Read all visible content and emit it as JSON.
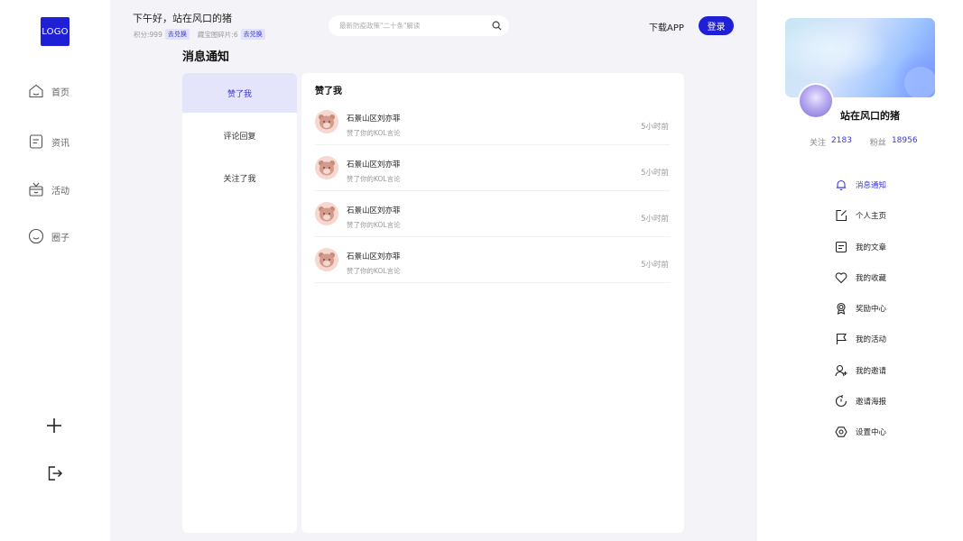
{
  "logo": {
    "text": "LOGO"
  },
  "leftnav": {
    "items": [
      {
        "label": "首页",
        "icon": "home-icon"
      },
      {
        "label": "资讯",
        "icon": "news-icon"
      },
      {
        "label": "活动",
        "icon": "gift-icon"
      },
      {
        "label": "圈子",
        "icon": "smile-icon"
      }
    ],
    "add_icon": "plus-icon",
    "logout_icon": "logout-icon"
  },
  "header": {
    "greeting": "下午好，站在风口的猪",
    "points_label": "积分:999",
    "redeem_label": "去兑换",
    "fragments_label": "藏宝图碎片:6",
    "redeem2_label": "去兑换",
    "search_placeholder": "最新防疫政策\"二十条\"解读",
    "download_label": "下载APP",
    "login_label": "登录"
  },
  "page": {
    "title": "消息通知"
  },
  "tabs": [
    {
      "label": "赞了我",
      "active": true
    },
    {
      "label": "评论回复",
      "active": false
    },
    {
      "label": "关注了我",
      "active": false
    }
  ],
  "content": {
    "title": "赞了我",
    "items": [
      {
        "name": "石景山区刘亦菲",
        "desc": "赞了你的KOL言论",
        "time": "5小时前"
      },
      {
        "name": "石景山区刘亦菲",
        "desc": "赞了你的KOL言论",
        "time": "5小时前"
      },
      {
        "name": "石景山区刘亦菲",
        "desc": "赞了你的KOL言论",
        "time": "5小时前"
      },
      {
        "name": "石景山区刘亦菲",
        "desc": "赞了你的KOL言论",
        "time": "5小时前"
      }
    ]
  },
  "profile": {
    "name": "站在风口的猪",
    "following_label": "关注",
    "following_count": "2183",
    "fans_label": "粉丝",
    "fans_count": "18956"
  },
  "menu": [
    {
      "label": "消息通知",
      "icon": "bell-icon",
      "active": true
    },
    {
      "label": "个人主页",
      "icon": "edit-icon",
      "active": false
    },
    {
      "label": "我的文章",
      "icon": "article-icon",
      "active": false
    },
    {
      "label": "我的收藏",
      "icon": "heart-icon",
      "active": false
    },
    {
      "label": "奖励中心",
      "icon": "award-icon",
      "active": false
    },
    {
      "label": "我的活动",
      "icon": "flag-icon",
      "active": false
    },
    {
      "label": "我的邀请",
      "icon": "user-add-icon",
      "active": false
    },
    {
      "label": "邀请海报",
      "icon": "refresh-icon",
      "active": false
    },
    {
      "label": "设置中心",
      "icon": "settings-icon",
      "active": false
    }
  ],
  "colors": {
    "accent": "#1f1fd6",
    "active_tab_bg": "#e4e5fb",
    "page_bg": "#f4f4f8"
  }
}
